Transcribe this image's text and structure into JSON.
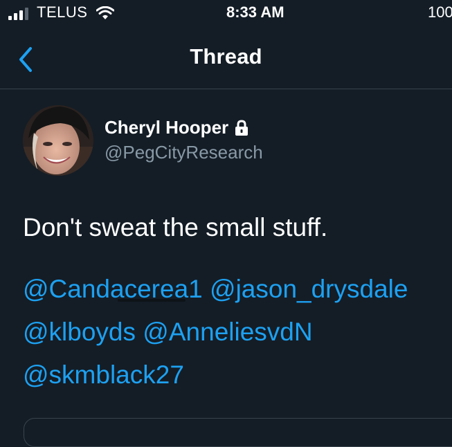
{
  "status_bar": {
    "carrier": "TELUS",
    "time": "8:33 AM",
    "battery": "100"
  },
  "nav": {
    "title": "Thread",
    "back_icon": "chevron-left-icon"
  },
  "tweet": {
    "display_name": "Cheryl Hooper",
    "handle": "@PegCityResearch",
    "protected_icon": "lock-icon",
    "text": "Don't sweat the small stuff.",
    "mentions": [
      "@Candacerea1",
      "@jason_drysdale",
      "@klboyds",
      "@AnneliesvdN",
      "@skmblack27"
    ]
  },
  "colors": {
    "background": "#141d26",
    "accent": "#1da1f2",
    "secondary_text": "#8899a6",
    "divider": "#38444d"
  }
}
